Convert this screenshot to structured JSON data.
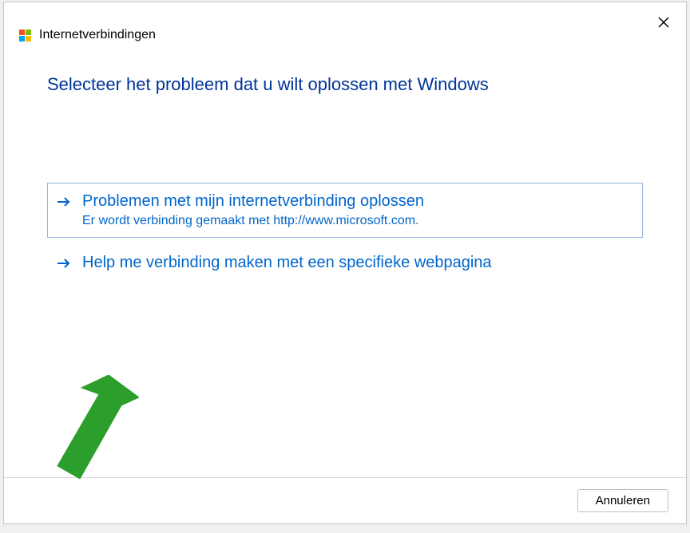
{
  "window": {
    "title": "Internetverbindingen"
  },
  "heading": "Selecteer het probleem dat u wilt oplossen met Windows",
  "options": {
    "troubleshoot": {
      "title": "Problemen met mijn internetverbinding oplossen",
      "desc": "Er wordt verbinding gemaakt met http://www.microsoft.com."
    },
    "webpage": {
      "title": "Help me verbinding maken met een specifieke webpagina"
    }
  },
  "buttons": {
    "cancel": "Annuleren"
  }
}
